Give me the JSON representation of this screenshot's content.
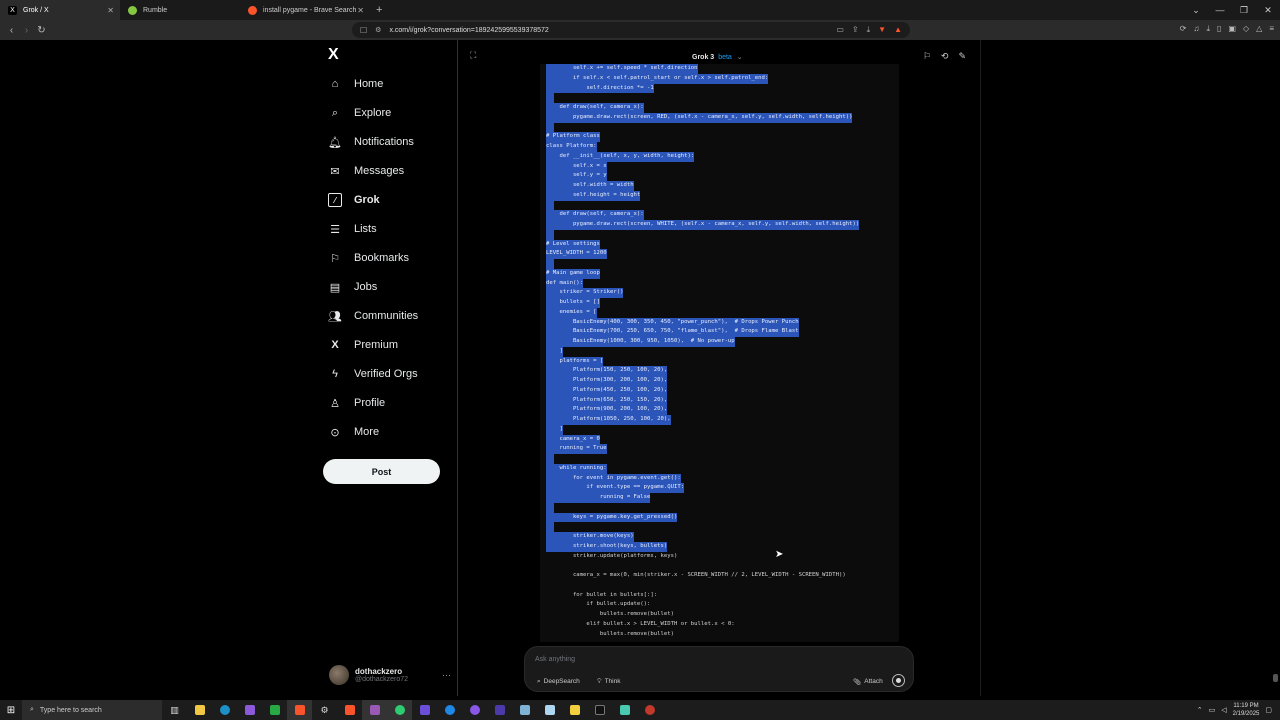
{
  "browser": {
    "tabs": [
      {
        "title": "Grok / X",
        "active": true,
        "icon": "x-icon"
      },
      {
        "title": "Rumble",
        "active": false,
        "icon": "rumble-icon"
      },
      {
        "title": "install pygame - Brave Search",
        "active": false,
        "icon": "brave-icon"
      }
    ],
    "new_tab": "+",
    "url": "x.com/i/grok?conversation=1892425995539378572"
  },
  "nav": {
    "logo": "X",
    "items": [
      {
        "label": "Home",
        "icon": "home-icon"
      },
      {
        "label": "Explore",
        "icon": "search-icon"
      },
      {
        "label": "Notifications",
        "icon": "bell-icon"
      },
      {
        "label": "Messages",
        "icon": "mail-icon"
      },
      {
        "label": "Grok",
        "icon": "grok-icon",
        "active": true
      },
      {
        "label": "Lists",
        "icon": "list-icon"
      },
      {
        "label": "Bookmarks",
        "icon": "bookmark-icon"
      },
      {
        "label": "Jobs",
        "icon": "briefcase-icon"
      },
      {
        "label": "Communities",
        "icon": "people-icon"
      },
      {
        "label": "Premium",
        "icon": "x-premium-icon"
      },
      {
        "label": "Verified Orgs",
        "icon": "lightning-icon"
      },
      {
        "label": "Profile",
        "icon": "person-icon"
      },
      {
        "label": "More",
        "icon": "more-circle-icon"
      }
    ],
    "post_label": "Post",
    "user": {
      "name": "dothackzero",
      "handle": "@dothackzero72",
      "more": "···"
    }
  },
  "grok": {
    "title": "Grok 3",
    "badge": "beta",
    "code_lines": [
      {
        "text": "        self.x += self.speed * self.direction",
        "sel": true
      },
      {
        "text": "        if self.x < self.patrol_start or self.x > self.patrol_end:",
        "sel": true
      },
      {
        "text": "            self.direction *= -1",
        "sel": true
      },
      {
        "text": "",
        "sel": true
      },
      {
        "text": "    def draw(self, camera_x):",
        "sel": true
      },
      {
        "text": "        pygame.draw.rect(screen, RED, (self.x - camera_x, self.y, self.width, self.height))",
        "sel": true
      },
      {
        "text": "",
        "sel": true
      },
      {
        "text": "# Platform class",
        "sel": true
      },
      {
        "text": "class Platform:",
        "sel": true
      },
      {
        "text": "    def __init__(self, x, y, width, height):",
        "sel": true
      },
      {
        "text": "        self.x = x",
        "sel": true
      },
      {
        "text": "        self.y = y",
        "sel": true
      },
      {
        "text": "        self.width = width",
        "sel": true
      },
      {
        "text": "        self.height = height",
        "sel": true
      },
      {
        "text": "",
        "sel": true
      },
      {
        "text": "    def draw(self, camera_x):",
        "sel": true
      },
      {
        "text": "        pygame.draw.rect(screen, WHITE, (self.x - camera_x, self.y, self.width, self.height))",
        "sel": true
      },
      {
        "text": "",
        "sel": true
      },
      {
        "text": "# Level settings",
        "sel": true
      },
      {
        "text": "LEVEL_WIDTH = 1200",
        "sel": true
      },
      {
        "text": "",
        "sel": true
      },
      {
        "text": "# Main game loop",
        "sel": true
      },
      {
        "text": "def main():",
        "sel": true
      },
      {
        "text": "    striker = Striker()",
        "sel": true
      },
      {
        "text": "    bullets = []",
        "sel": true
      },
      {
        "text": "    enemies = [",
        "sel": true
      },
      {
        "text": "        BasicEnemy(400, 300, 350, 450, \"power_punch\"),  # Drops Power Punch",
        "sel": true
      },
      {
        "text": "        BasicEnemy(700, 250, 650, 750, \"flame_blast\"),  # Drops Flame Blast",
        "sel": true
      },
      {
        "text": "        BasicEnemy(1000, 300, 950, 1050),  # No power-up",
        "sel": true
      },
      {
        "text": "    ]",
        "sel": true
      },
      {
        "text": "    platforms = [",
        "sel": true
      },
      {
        "text": "        Platform(150, 250, 100, 20),",
        "sel": true
      },
      {
        "text": "        Platform(300, 200, 100, 20),",
        "sel": true
      },
      {
        "text": "        Platform(450, 250, 100, 20),",
        "sel": true
      },
      {
        "text": "        Platform(650, 250, 150, 20),",
        "sel": true
      },
      {
        "text": "        Platform(900, 200, 100, 20),",
        "sel": true
      },
      {
        "text": "        Platform(1050, 250, 100, 20),",
        "sel": true
      },
      {
        "text": "    ]",
        "sel": true
      },
      {
        "text": "    camera_x = 0",
        "sel": true
      },
      {
        "text": "    running = True",
        "sel": true
      },
      {
        "text": "",
        "sel": true
      },
      {
        "text": "    while running:",
        "sel": true
      },
      {
        "text": "        for event in pygame.event.get():",
        "sel": true
      },
      {
        "text": "            if event.type == pygame.QUIT:",
        "sel": true
      },
      {
        "text": "                running = False",
        "sel": true
      },
      {
        "text": "",
        "sel": true
      },
      {
        "text": "        keys = pygame.key.get_pressed()",
        "sel": true
      },
      {
        "text": "",
        "sel": true
      },
      {
        "text": "        striker.move(keys)",
        "sel": true
      },
      {
        "text": "        striker.shoot(keys, bullets)",
        "sel": true
      },
      {
        "text": "        striker.update(platforms, keys)",
        "sel": false
      },
      {
        "text": "",
        "sel": false
      },
      {
        "text": "        camera_x = max(0, min(striker.x - SCREEN_WIDTH // 2, LEVEL_WIDTH - SCREEN_WIDTH))",
        "sel": false
      },
      {
        "text": "",
        "sel": false
      },
      {
        "text": "        for bullet in bullets[:]:",
        "sel": false
      },
      {
        "text": "            if bullet.update():",
        "sel": false
      },
      {
        "text": "                bullets.remove(bullet)",
        "sel": false
      },
      {
        "text": "            elif bullet.x > LEVEL_WIDTH or bullet.x < 0:",
        "sel": false
      },
      {
        "text": "                bullets.remove(bullet)",
        "sel": false
      }
    ],
    "input_placeholder": "Ask anything",
    "deepsearch_label": "DeepSearch",
    "think_label": "Think",
    "attach_label": "Attach"
  },
  "taskbar": {
    "search_placeholder": "Type here to search",
    "time": "11:19 PM",
    "date": "2/19/2025"
  },
  "colors": {
    "selection": "#2b55b8",
    "post_button": "#eff3f4",
    "beta_badge": "#1d9bf0"
  }
}
